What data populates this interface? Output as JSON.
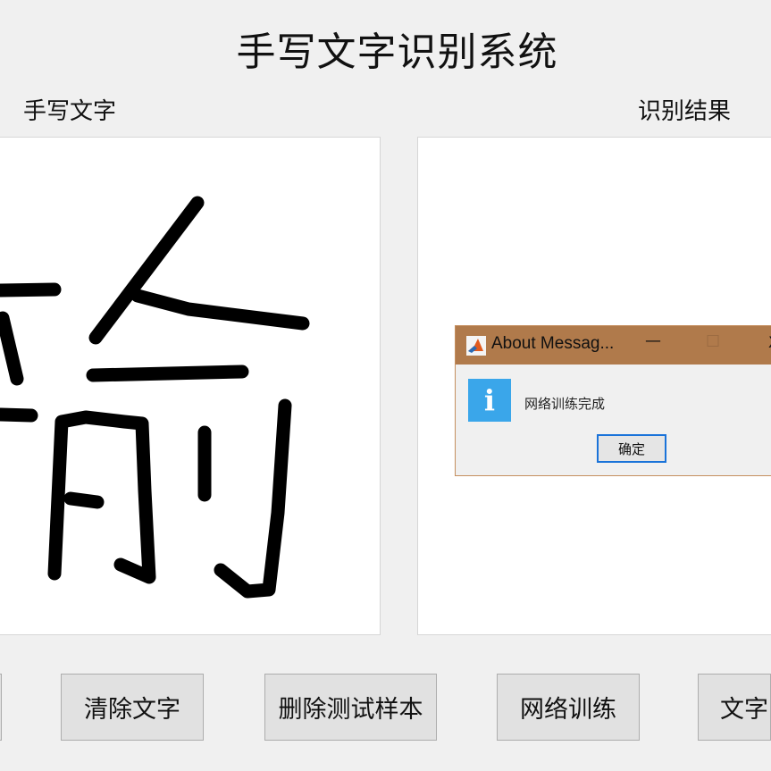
{
  "app": {
    "title": "手写文字识别系统"
  },
  "panels": {
    "input_label": "手写文字",
    "output_label": "识别结果"
  },
  "buttons": {
    "clear_text": "清除文字",
    "delete_samples": "删除测试样本",
    "train_network": "网络训练",
    "recognize": "文字"
  },
  "dialog": {
    "title": "About Messag...",
    "message": "网络训练完成",
    "ok_label": "确定",
    "minimize_glyph": "—",
    "maximize_glyph": "☐",
    "close_glyph": "X",
    "info_glyph": "i",
    "title_bar_color": "#b07a4b",
    "info_icon_color": "#3aa6ea"
  }
}
